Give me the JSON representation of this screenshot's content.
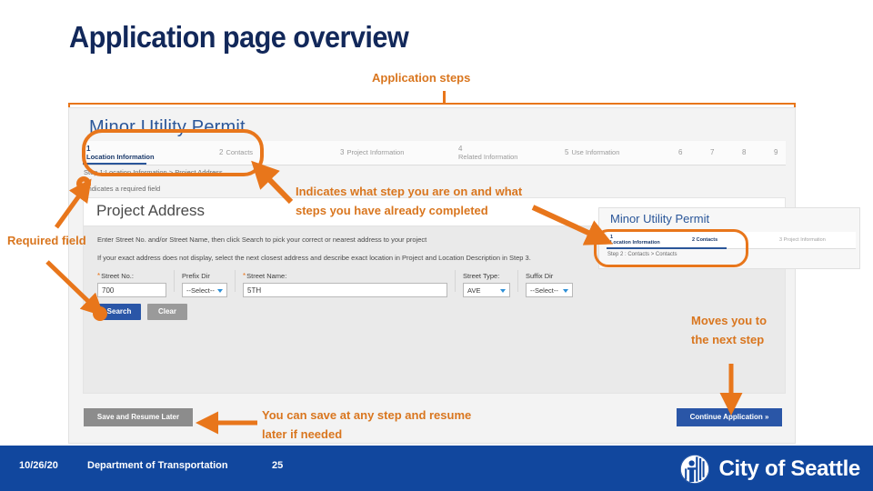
{
  "slide": {
    "title": "Application page overview",
    "colors": {
      "navy": "#12285a",
      "orange": "#e8761b",
      "blue": "#11479e",
      "link_blue": "#2a5699"
    }
  },
  "callouts": {
    "application_steps": "Application steps",
    "required_field": "Required field",
    "step_indicator": "Indicates what step you are on and what steps you have already completed",
    "next_step": "Moves you to the next step",
    "save_resume": "You can save at any step and resume later if needed"
  },
  "app": {
    "title": "Minor Utility Permit",
    "steps": [
      {
        "num": "1",
        "label": "Location Information"
      },
      {
        "num": "2",
        "label": "Contacts"
      },
      {
        "num": "3",
        "label": "Project Information"
      },
      {
        "num": "4",
        "label": "Related Information"
      },
      {
        "num": "5",
        "label": "Use Information"
      },
      {
        "num": "6",
        "label": ""
      },
      {
        "num": "7",
        "label": ""
      },
      {
        "num": "8",
        "label": ""
      },
      {
        "num": "9",
        "label": ""
      }
    ],
    "breadcrumb": "Step 1:Location Information > Project Address",
    "required_note": "*indicates a required field",
    "section": {
      "heading": "Project Address",
      "hint_1": "Enter Street No. and/or Street Name, then click Search to pick your correct or nearest address to your project",
      "hint_2": "If your exact address does not display, select the next closest address and describe exact location in Project and Location Description in Step 3.",
      "fields": [
        {
          "label": "Street No.:",
          "value": "700",
          "required": "*",
          "type": "text"
        },
        {
          "label": "Prefix Dir",
          "value": "--Select--",
          "required": "",
          "type": "select"
        },
        {
          "label": "Street Name:",
          "value": "5TH",
          "required": "*",
          "type": "text"
        },
        {
          "label": "Street Type:",
          "value": "AVE",
          "required": "",
          "type": "select"
        },
        {
          "label": "Suffix Dir",
          "value": "--Select--",
          "required": "",
          "type": "select"
        }
      ],
      "search_button": "Search",
      "clear_button": "Clear"
    },
    "save_button": "Save and Resume Later",
    "continue_button": "Continue Application »",
    "marker_asterisk": "*"
  },
  "inset": {
    "title": "Minor Utility Permit",
    "steps": [
      {
        "num": "1",
        "label": "Location Information"
      },
      {
        "num": "2",
        "label": "Contacts"
      },
      {
        "num": "3",
        "label": "Project Information"
      }
    ],
    "breadcrumb": "Step 2 : Contacts > Contacts"
  },
  "footer": {
    "date": "10/26/20",
    "department": "Department of Transportation",
    "page": "25",
    "brand": "City of Seattle"
  }
}
